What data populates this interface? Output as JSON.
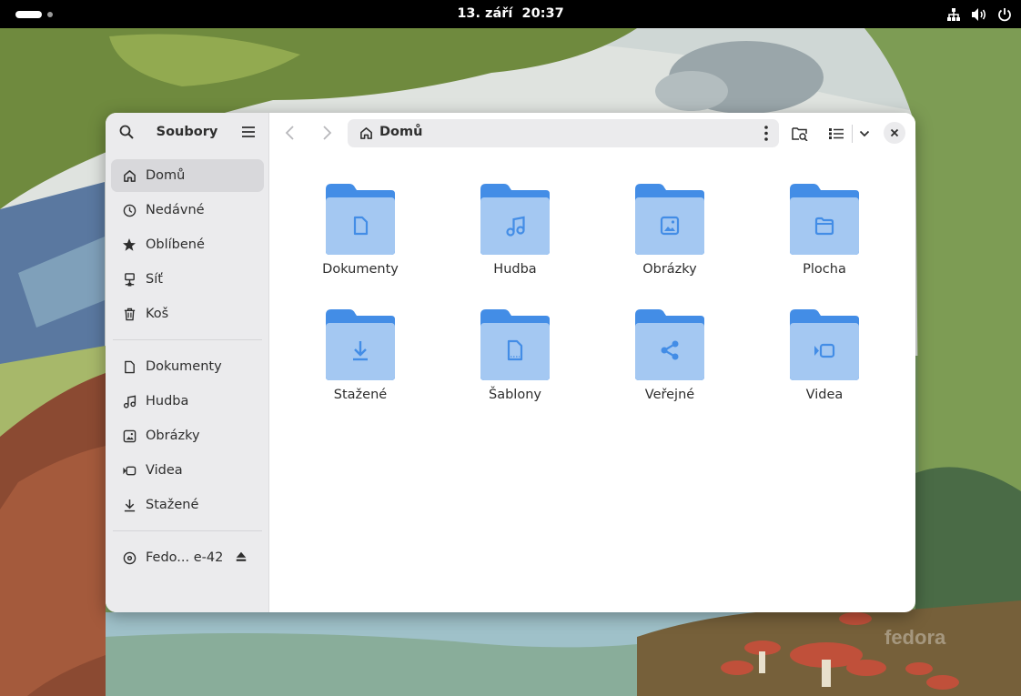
{
  "topbar": {
    "date": "13. září",
    "time": "20:37"
  },
  "window": {
    "sidebar_title": "Soubory",
    "places": [
      {
        "label": "Domů",
        "icon": "home-icon",
        "active": true
      },
      {
        "label": "Nedávné",
        "icon": "clock-icon"
      },
      {
        "label": "Oblíbené",
        "icon": "star-icon"
      },
      {
        "label": "Síť",
        "icon": "network-icon"
      },
      {
        "label": "Koš",
        "icon": "trash-icon"
      }
    ],
    "bookmarks": [
      {
        "label": "Dokumenty",
        "icon": "document-icon"
      },
      {
        "label": "Hudba",
        "icon": "music-icon"
      },
      {
        "label": "Obrázky",
        "icon": "image-icon"
      },
      {
        "label": "Videa",
        "icon": "video-icon"
      },
      {
        "label": "Stažené",
        "icon": "download-icon"
      }
    ],
    "device": {
      "label": "Fedo... e-42",
      "icon": "disc-icon"
    },
    "path": "Domů",
    "folders": [
      {
        "label": "Dokumenty",
        "icon": "document-icon"
      },
      {
        "label": "Hudba",
        "icon": "music-icon"
      },
      {
        "label": "Obrázky",
        "icon": "image-icon"
      },
      {
        "label": "Plocha",
        "icon": "folder-icon"
      },
      {
        "label": "Stažené",
        "icon": "download-icon"
      },
      {
        "label": "Šablony",
        "icon": "template-icon"
      },
      {
        "label": "Veřejné",
        "icon": "share-icon"
      },
      {
        "label": "Videa",
        "icon": "video-icon"
      }
    ]
  },
  "wallpaper": {
    "watermark": "fedora"
  },
  "colors": {
    "folder": "#438de6",
    "folder_light": "#a4c8f2",
    "accent": "#3584e4"
  }
}
